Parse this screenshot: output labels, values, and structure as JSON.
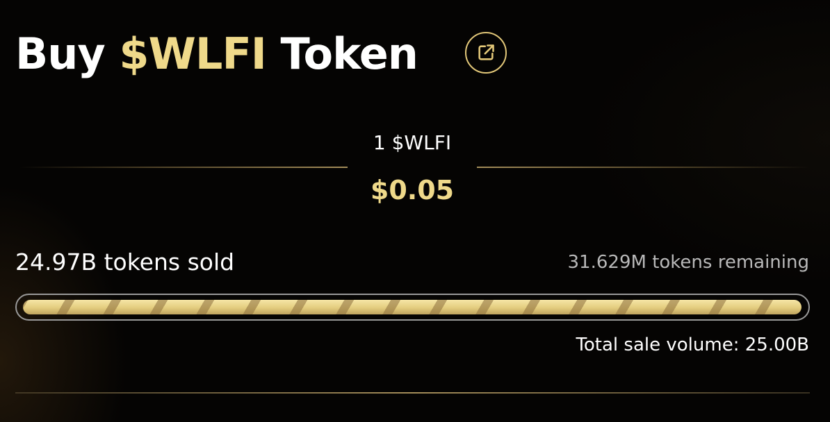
{
  "header": {
    "title_prefix": "Buy",
    "title_token": "$WLFI",
    "title_suffix": "Token",
    "external_link_icon": "external-link-icon"
  },
  "price": {
    "label": "1 $WLFI",
    "value": "$0.05"
  },
  "sale": {
    "sold_text": "24.97B tokens sold",
    "remaining_text": "31.629M tokens remaining",
    "total_text": "Total sale volume: 25.00B",
    "progress_fraction": 0.9987
  },
  "colors": {
    "accent": "#efd98a",
    "background": "#050403",
    "text_primary": "#ffffff",
    "text_secondary": "#b9b9b9"
  }
}
